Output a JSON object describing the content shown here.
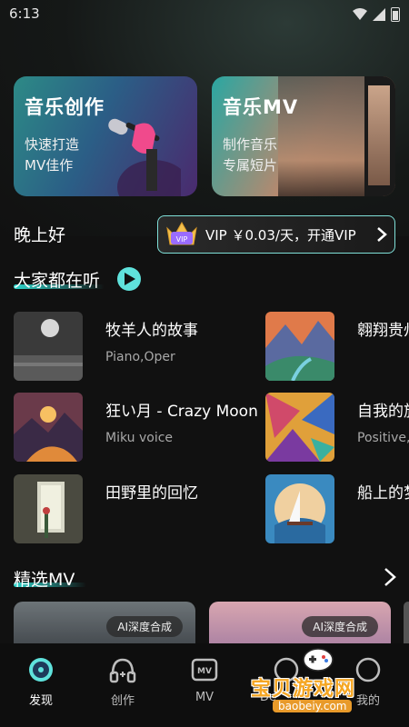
{
  "status_bar": {
    "time": "6:13"
  },
  "feature_cards": [
    {
      "title": "音乐创作",
      "line1": "快速打造",
      "line2": "MV佳作"
    },
    {
      "title": "音乐MV",
      "line1": "制作音乐",
      "line2": "专属短片"
    }
  ],
  "greeting": "晚上好",
  "vip_banner": {
    "text": "VIP ￥0.03/天，开通VIP"
  },
  "listening_section": {
    "title": "大家都在听"
  },
  "songs_left": [
    {
      "title": "牧羊人的故事",
      "meta": "Piano,Oper"
    },
    {
      "title": "狂い月 - Crazy Moon",
      "meta": "Miku voice"
    },
    {
      "title": "田野里的回忆",
      "meta": ""
    }
  ],
  "songs_right": [
    {
      "title": "翱翔贵州",
      "meta": ""
    },
    {
      "title": "自我的旅程",
      "meta": "Positive,"
    },
    {
      "title": "船上的梦",
      "meta": ""
    }
  ],
  "featured_mv": {
    "title": "精选MV",
    "badge": "AI深度合成"
  },
  "bottom_nav": [
    {
      "label": "发现",
      "icon": "disc-icon"
    },
    {
      "label": "创作",
      "icon": "headphones-icon"
    },
    {
      "label": "MV",
      "icon": "mv-icon"
    },
    {
      "label": "De",
      "icon": "compass-icon"
    },
    {
      "label": "我的",
      "icon": "profile-icon"
    }
  ],
  "watermark": {
    "text": "宝贝游戏网",
    "url": "baobeiy.com"
  },
  "colors": {
    "accent": "#5fe2dc",
    "background": "#111111"
  }
}
